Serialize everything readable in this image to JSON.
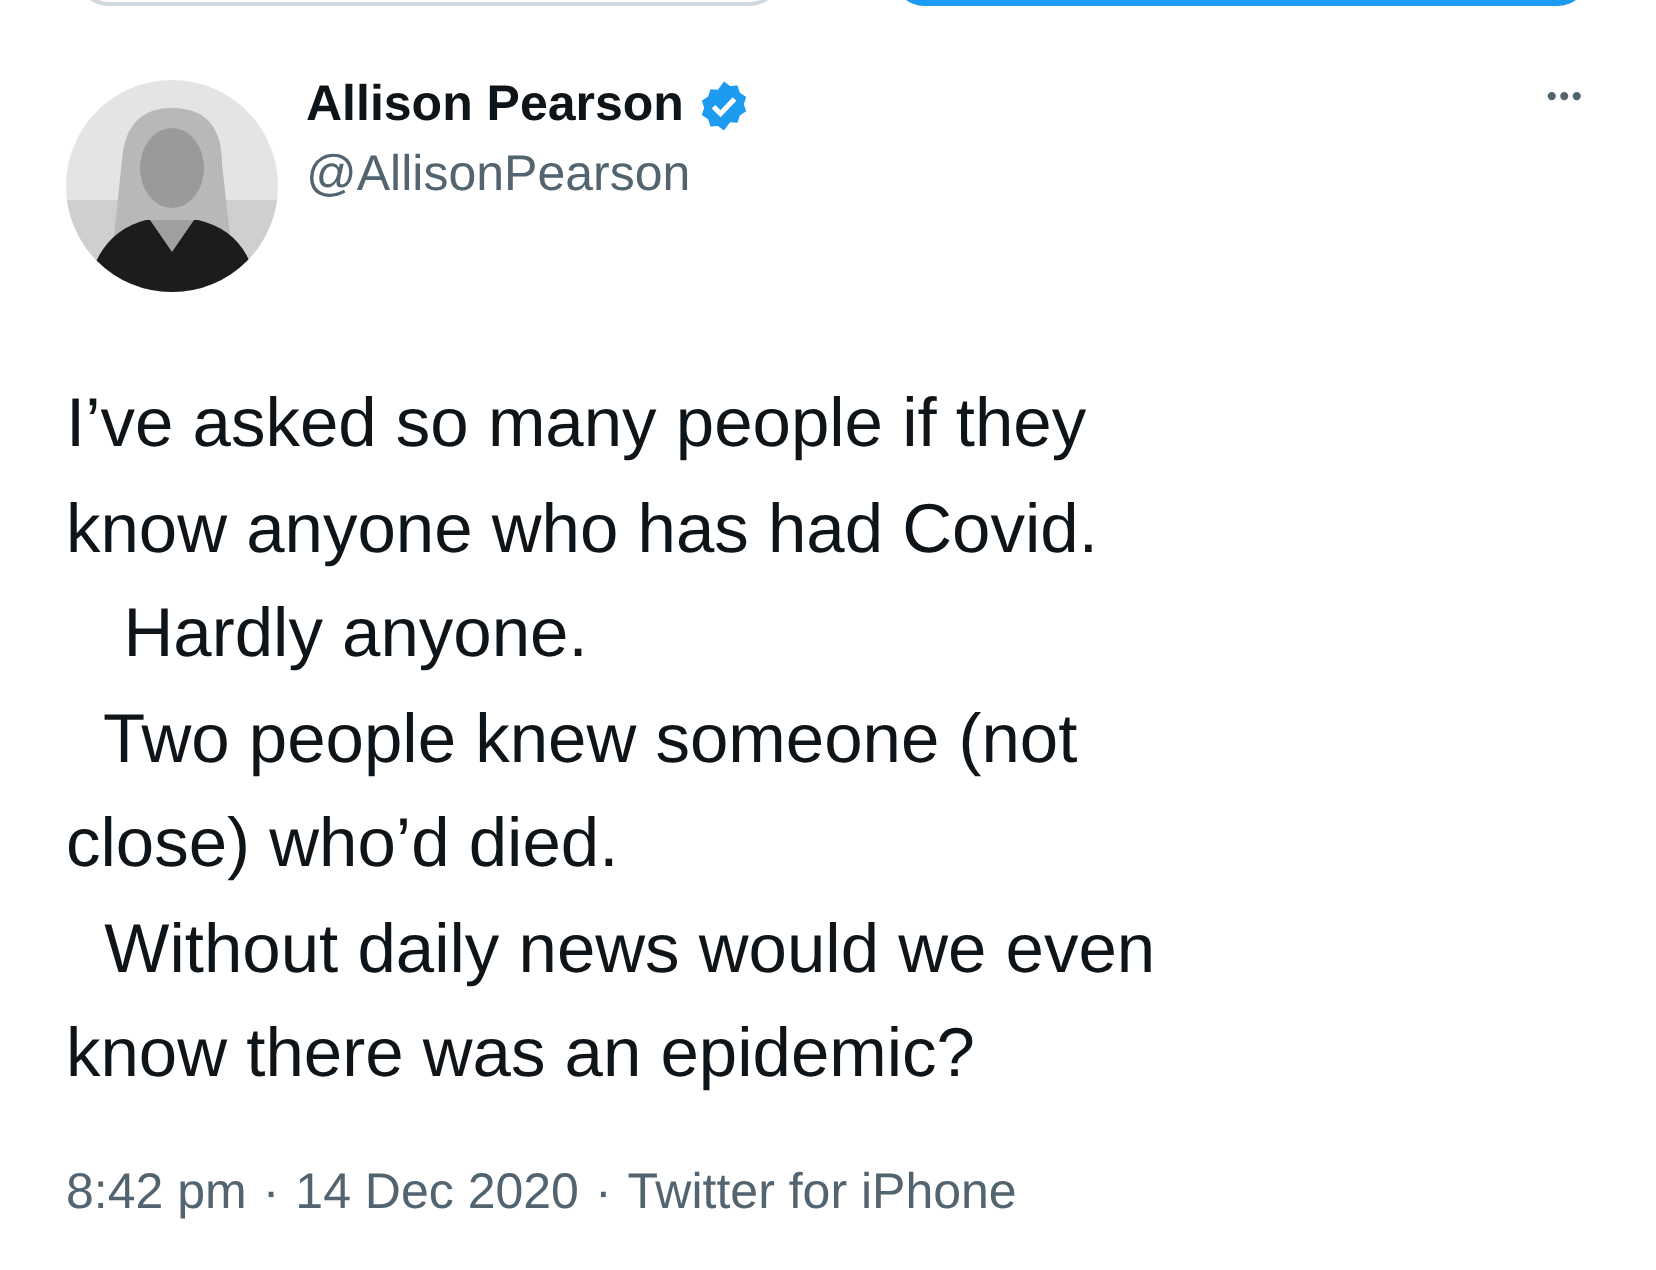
{
  "top_buttons": [
    {
      "kind": "outline"
    },
    {
      "kind": "filled"
    }
  ],
  "tweet": {
    "author": {
      "name": "Allison Pearson",
      "verified": true,
      "handle": "@AllisonPearson"
    },
    "more": "•••",
    "text_lines": [
      "I’ve asked so many people if they",
      "know anyone who has had Covid.",
      "   Hardly anyone.",
      "  Two people knew someone (not",
      "close) who’d died.",
      "  Without daily news would we even",
      "know there was an epidemic?"
    ],
    "meta": {
      "time": "8:42 pm",
      "separator_1": "·",
      "date": "14 Dec 2020",
      "separator_2": "·",
      "source": "Twitter for iPhone"
    }
  }
}
